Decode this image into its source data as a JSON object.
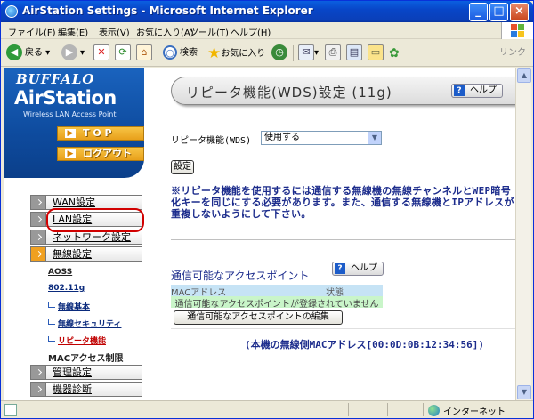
{
  "window": {
    "title": "AirStation Settings - Microsoft Internet Explorer",
    "min": "_",
    "max": "□",
    "close": "×"
  },
  "menu": [
    "ファイル(F)",
    "編集(E)",
    "表示(V)",
    "お気に入り(A)",
    "ツール(T)",
    "ヘルプ(H)"
  ],
  "toolbar": {
    "back": "戻る",
    "search": "検索",
    "favorites": "お気に入り",
    "links": "リンク"
  },
  "brand": {
    "buffalo": "BUFFALO",
    "airstation": "AirStation",
    "tagline": "Wireless LAN Access Point",
    "top": "T O P",
    "logout": "ログアウト"
  },
  "nav": {
    "wan": "WAN設定",
    "lan": "LAN設定",
    "network": "ネットワーク設定",
    "wireless": "無線設定",
    "aoss": "AOSS",
    "n80211g": "802.11g",
    "sub_basic": "無線基本",
    "sub_security": "無線セキュリティ",
    "sub_repeater": "リピータ機能",
    "mac_limit": "MACアクセス制限",
    "admin": "管理設定",
    "diag": "機器診断"
  },
  "main": {
    "title": "リピータ機能(WDS)設定 (11g)",
    "help": "ヘルプ",
    "repeater_label": "リピータ機能(WDS)",
    "repeater_value": "使用する",
    "apply": "設定",
    "notice": "※リピータ機能を使用するには通信する無線機の無線チャンネルとWEP暗号化キーを同じにする必要があります。また、通信する無線機とIPアドレスが重複しないようにして下さい。",
    "ap_section": "通信可能なアクセスポイント",
    "ap_help": "ヘルプ",
    "col_mac": "MACアドレス",
    "col_state": "状態",
    "no_ap": "通信可能なアクセスポイントが登録されていません",
    "edit_button": "通信可能なアクセスポイントの編集",
    "mac_info": "(本機の無線側MACアドレス[00:0D:0B:12:34:56])"
  },
  "status": {
    "zone": "インターネット"
  },
  "colors": {
    "accent": "#1C2C8C",
    "highlight": "#D10000",
    "nav_active": "#F0A020"
  }
}
